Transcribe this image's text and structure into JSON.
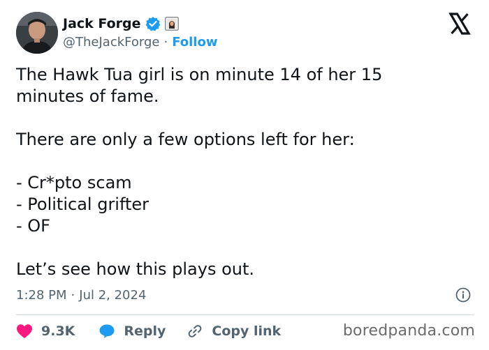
{
  "author": {
    "display_name": "Jack Forge",
    "handle": "@TheJackForge",
    "separator": "·",
    "follow_label": "Follow",
    "verified": true
  },
  "tweet": {
    "lines": [
      "The Hawk Tua girl is on minute 14 of her 15",
      "minutes of fame.",
      "There are only a few options left for her:",
      "- Cr*pto scam",
      "- Political grifter",
      "- OF",
      "Let’s see how this plays out."
    ],
    "time": "1:28 PM",
    "date_separator": "·",
    "date": "Jul 2, 2024"
  },
  "actions": {
    "like_count": "9.3K",
    "reply_label": "Reply",
    "copy_link_label": "Copy link"
  },
  "watermark": "boredpanda.com",
  "icons": {
    "brand": "x-logo-icon",
    "verified": "verified-badge-icon",
    "affiliate": "affiliate-avatar-icon",
    "info": "info-icon",
    "like": "heart-icon",
    "reply": "speech-bubble-icon",
    "copy_link": "link-icon"
  },
  "colors": {
    "text_primary": "#0f1419",
    "text_secondary": "#536471",
    "accent_blue": "#1d9bf0",
    "like_pink": "#f91880",
    "divider": "#cfd9de"
  }
}
